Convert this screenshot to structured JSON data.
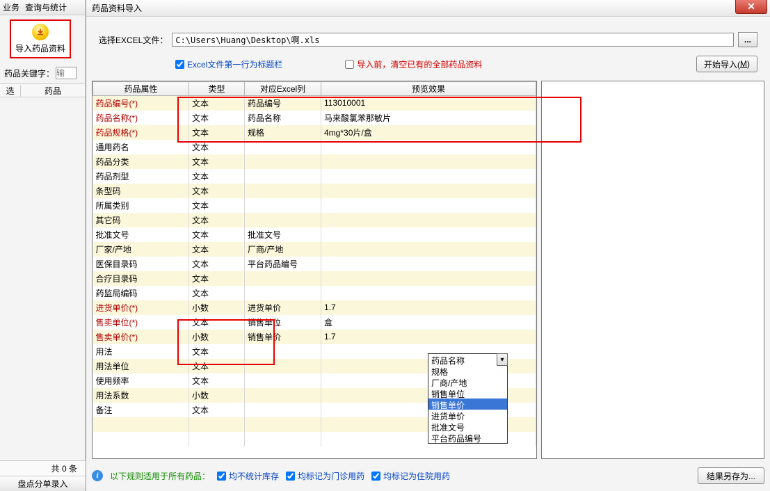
{
  "menu": {
    "item1": "业务",
    "item2": "查询与统计"
  },
  "left": {
    "import_btn_label": "导入药品资料",
    "keyword_label": "药品关键字：",
    "keyword_placeholder": "输",
    "sel_col1": "选",
    "sel_col2": "药品",
    "count_text": "共 0 条",
    "entry_btn": "盘点分单录入"
  },
  "dialog": {
    "title": "药品资料导入",
    "file_label": "选择EXCEL文件：",
    "file_path": "C:\\Users\\Huang\\Desktop\\啊.xls",
    "browse": "...",
    "chk_header": "Excel文件第一行为标题栏",
    "chk_clear": "导入前，清空已有的全部药品资料",
    "start_btn": "开始导入(",
    "start_btn_u": "M",
    "start_btn_end": ")"
  },
  "headers": {
    "attr": "药品属性",
    "type": "类型",
    "excel": "对应Excel列",
    "preview": "预览效果"
  },
  "rows": [
    {
      "attr": "药品编号(*)",
      "req": true,
      "type": "文本",
      "excel": "药品编号",
      "prev": "113010001"
    },
    {
      "attr": "药品名称(*)",
      "req": true,
      "type": "文本",
      "excel": "药品名称",
      "prev": "马来酸氯苯那敏片"
    },
    {
      "attr": "药品规格(*)",
      "req": true,
      "type": "文本",
      "excel": "规格",
      "prev": "4mg*30片/盒"
    },
    {
      "attr": "通用药名",
      "req": false,
      "type": "文本",
      "excel": "",
      "prev": ""
    },
    {
      "attr": "药品分类",
      "req": false,
      "type": "文本",
      "excel": "",
      "prev": ""
    },
    {
      "attr": "药品剂型",
      "req": false,
      "type": "文本",
      "excel": "",
      "prev": ""
    },
    {
      "attr": "条型码",
      "req": false,
      "type": "文本",
      "excel": "",
      "prev": ""
    },
    {
      "attr": "所属类别",
      "req": false,
      "type": "文本",
      "excel": "",
      "prev": ""
    },
    {
      "attr": "其它码",
      "req": false,
      "type": "文本",
      "excel": "",
      "prev": ""
    },
    {
      "attr": "批准文号",
      "req": false,
      "type": "文本",
      "excel": "批准文号",
      "prev": ""
    },
    {
      "attr": "厂家/产地",
      "req": false,
      "type": "文本",
      "excel": "厂商/产地",
      "prev": ""
    },
    {
      "attr": "医保目录码",
      "req": false,
      "type": "文本",
      "excel": "平台药品编号",
      "prev": ""
    },
    {
      "attr": "合疗目录码",
      "req": false,
      "type": "文本",
      "excel": "",
      "prev": ""
    },
    {
      "attr": "药监局编码",
      "req": false,
      "type": "文本",
      "excel": "",
      "prev": ""
    },
    {
      "attr": "进货单价(*)",
      "req": true,
      "type": "小数",
      "excel": "进货单价",
      "prev": "1.7"
    },
    {
      "attr": "售卖单位(*)",
      "req": true,
      "type": "文本",
      "excel": "销售单位",
      "prev": "盒"
    },
    {
      "attr": "售卖单价(*)",
      "req": true,
      "type": "小数",
      "excel": "销售单价",
      "prev": "1.7"
    },
    {
      "attr": "用法",
      "req": false,
      "type": "文本",
      "excel": "",
      "prev": ""
    },
    {
      "attr": "用法单位",
      "req": false,
      "type": "文本",
      "excel": "",
      "prev": ""
    },
    {
      "attr": "使用频率",
      "req": false,
      "type": "文本",
      "excel": "",
      "prev": ""
    },
    {
      "attr": "用法系数",
      "req": false,
      "type": "小数",
      "excel": "",
      "prev": ""
    },
    {
      "attr": "备注",
      "req": false,
      "type": "文本",
      "excel": "",
      "prev": ""
    }
  ],
  "dropdown": {
    "items": [
      "药品名称",
      "规格",
      "厂商/产地",
      "销售单位",
      "销售单价",
      "进货单价",
      "批准文号",
      "平台药品编号"
    ],
    "selected_index": 4
  },
  "footer": {
    "rule_text": "以下规则适用于所有药品：",
    "chk1": "均不统计库存",
    "chk2": "均标记为门诊用药",
    "chk3": "均标记为住院用药",
    "result_btn": "结果另存为..."
  }
}
